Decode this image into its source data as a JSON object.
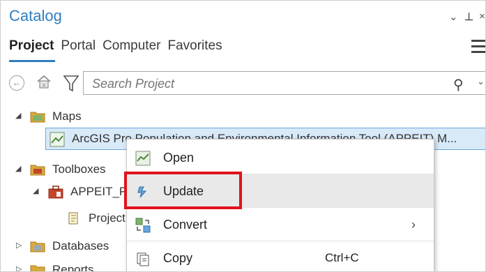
{
  "panel": {
    "title": "Catalog",
    "controls": {
      "dropdown": "⌄",
      "pin": "⊥",
      "close": "×"
    }
  },
  "tabs": [
    {
      "label": "Project",
      "active": true
    },
    {
      "label": "Portal",
      "active": false
    },
    {
      "label": "Computer",
      "active": false
    },
    {
      "label": "Favorites",
      "active": false
    }
  ],
  "search": {
    "placeholder": "Search Project"
  },
  "tree": {
    "maps": "Maps",
    "map_item": "ArcGIS Pro Population and Environmental Information Tool (APPEIT) M...",
    "toolboxes": "Toolboxes",
    "toolbox_item": "APPEIT_Pro",
    "project_item": "Project",
    "databases": "Databases",
    "reports": "Reports"
  },
  "context_menu": {
    "open": "Open",
    "update": "Update",
    "convert": "Convert",
    "copy": "Copy",
    "copy_shortcut": "Ctrl+C"
  },
  "colors": {
    "accent": "#2f7ec1",
    "highlight": "#e1131b",
    "selection": "#d8e9f8"
  }
}
